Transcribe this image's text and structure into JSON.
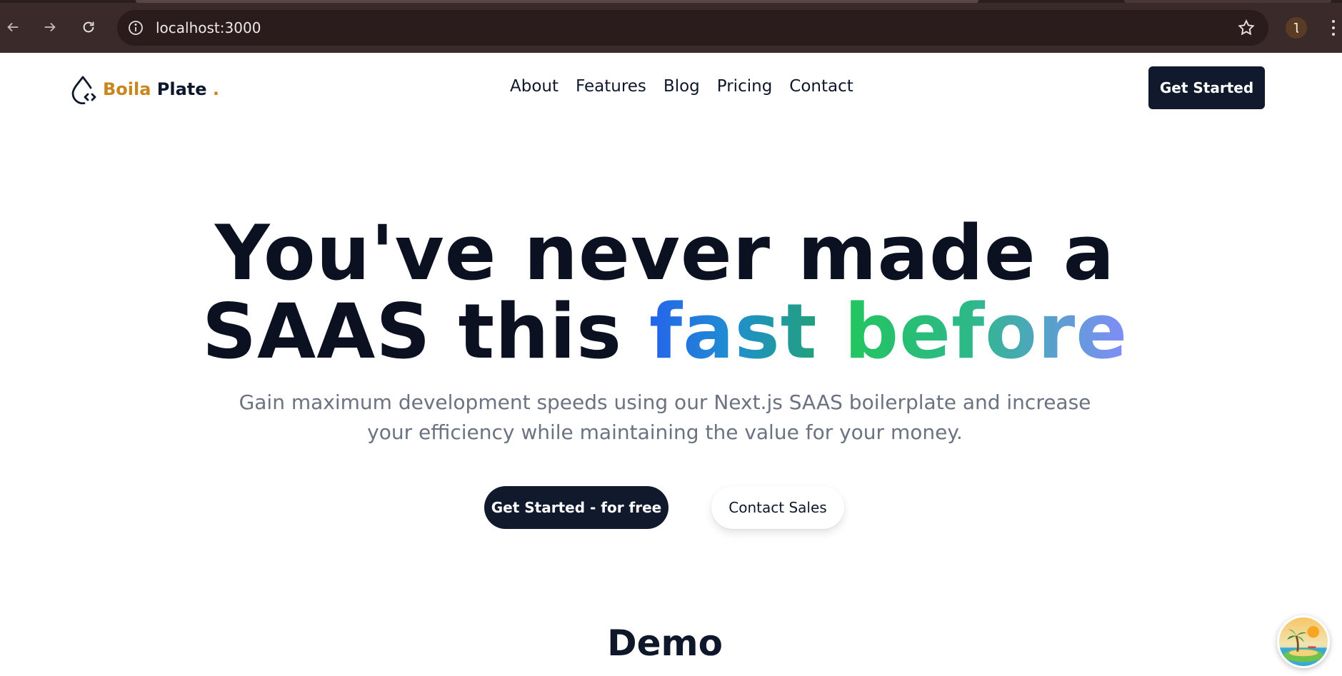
{
  "browser": {
    "url": "localhost:3000",
    "icons": {
      "back": "arrow-left-icon",
      "forward": "arrow-right-icon",
      "reload": "reload-icon",
      "site_info": "info-icon",
      "bookmark": "star-icon",
      "profile": "profile-avatar",
      "menu": "kebab-menu-icon"
    }
  },
  "header": {
    "logo": {
      "icon": "drop-code-icon",
      "brand_part1": "Boila",
      "brand_part2": "Plate",
      "brand_dot": "."
    },
    "nav": [
      "About",
      "Features",
      "Blog",
      "Pricing",
      "Contact"
    ],
    "cta_label": "Get Started"
  },
  "hero": {
    "title_line1": "You've never made a",
    "title_line2_plain": "SAAS this",
    "title_line2_accent1": "fast",
    "title_line2_accent2": "before",
    "subtitle": "Gain maximum development speeds using our Next.js SAAS boilerplate and increase your efficiency while maintaining the value for your money.",
    "primary_button": "Get Started - for free",
    "secondary_button": "Contact Sales"
  },
  "demo": {
    "title": "Demo"
  },
  "colors": {
    "brand_gold": "#c8861d",
    "dark_navy": "#111a2c",
    "text_dark": "#0b1120",
    "muted_text": "#6b7280",
    "gradient_blue": "#2563eb",
    "gradient_green": "#22c55e",
    "gradient_violet": "#818cf8"
  }
}
